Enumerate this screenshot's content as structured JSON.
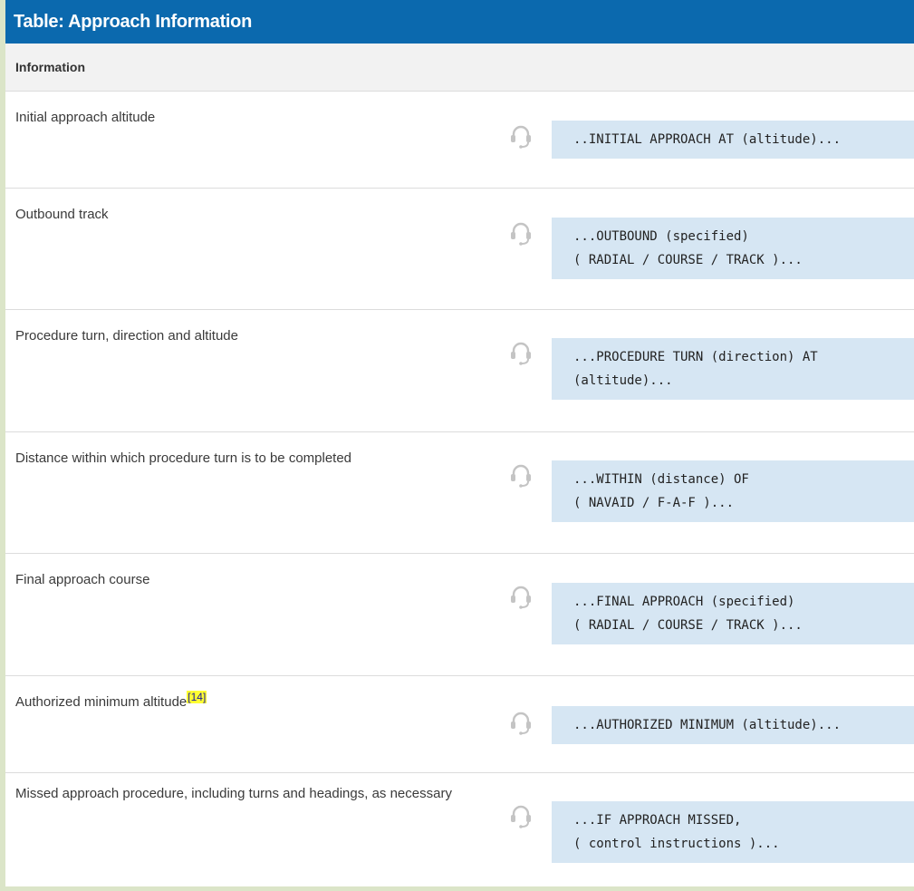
{
  "table": {
    "title": "Table: Approach Information",
    "column_header": "Information",
    "rows": [
      {
        "label": "Initial approach altitude",
        "phrase": "..INITIAL APPROACH AT (altitude)..."
      },
      {
        "label": "Outbound track",
        "phrase": "...OUTBOUND (specified)\n( RADIAL / COURSE / TRACK )..."
      },
      {
        "label": "Procedure turn, direction and altitude",
        "phrase": "...PROCEDURE TURN (direction) AT\n(altitude)..."
      },
      {
        "label": "Distance within which procedure turn is to be completed",
        "phrase": "...WITHIN (distance) OF\n( NAVAID / F-A-F )..."
      },
      {
        "label": "Final approach course",
        "phrase": "...FINAL APPROACH (specified)\n( RADIAL / COURSE / TRACK )..."
      },
      {
        "label": "Authorized minimum altitude",
        "footnote": "[14]",
        "phrase": "...AUTHORIZED MINIMUM (altitude)..."
      },
      {
        "label": "Missed approach procedure, including turns and headings, as necessary",
        "phrase": "...IF APPROACH MISSED,\n( control instructions )..."
      }
    ]
  },
  "icons": {
    "row_icon": "headset-icon"
  },
  "colors": {
    "title_bar": "#0b69ae",
    "phrase_bg": "#d6e6f3",
    "footnote_highlight": "#ffff33"
  }
}
